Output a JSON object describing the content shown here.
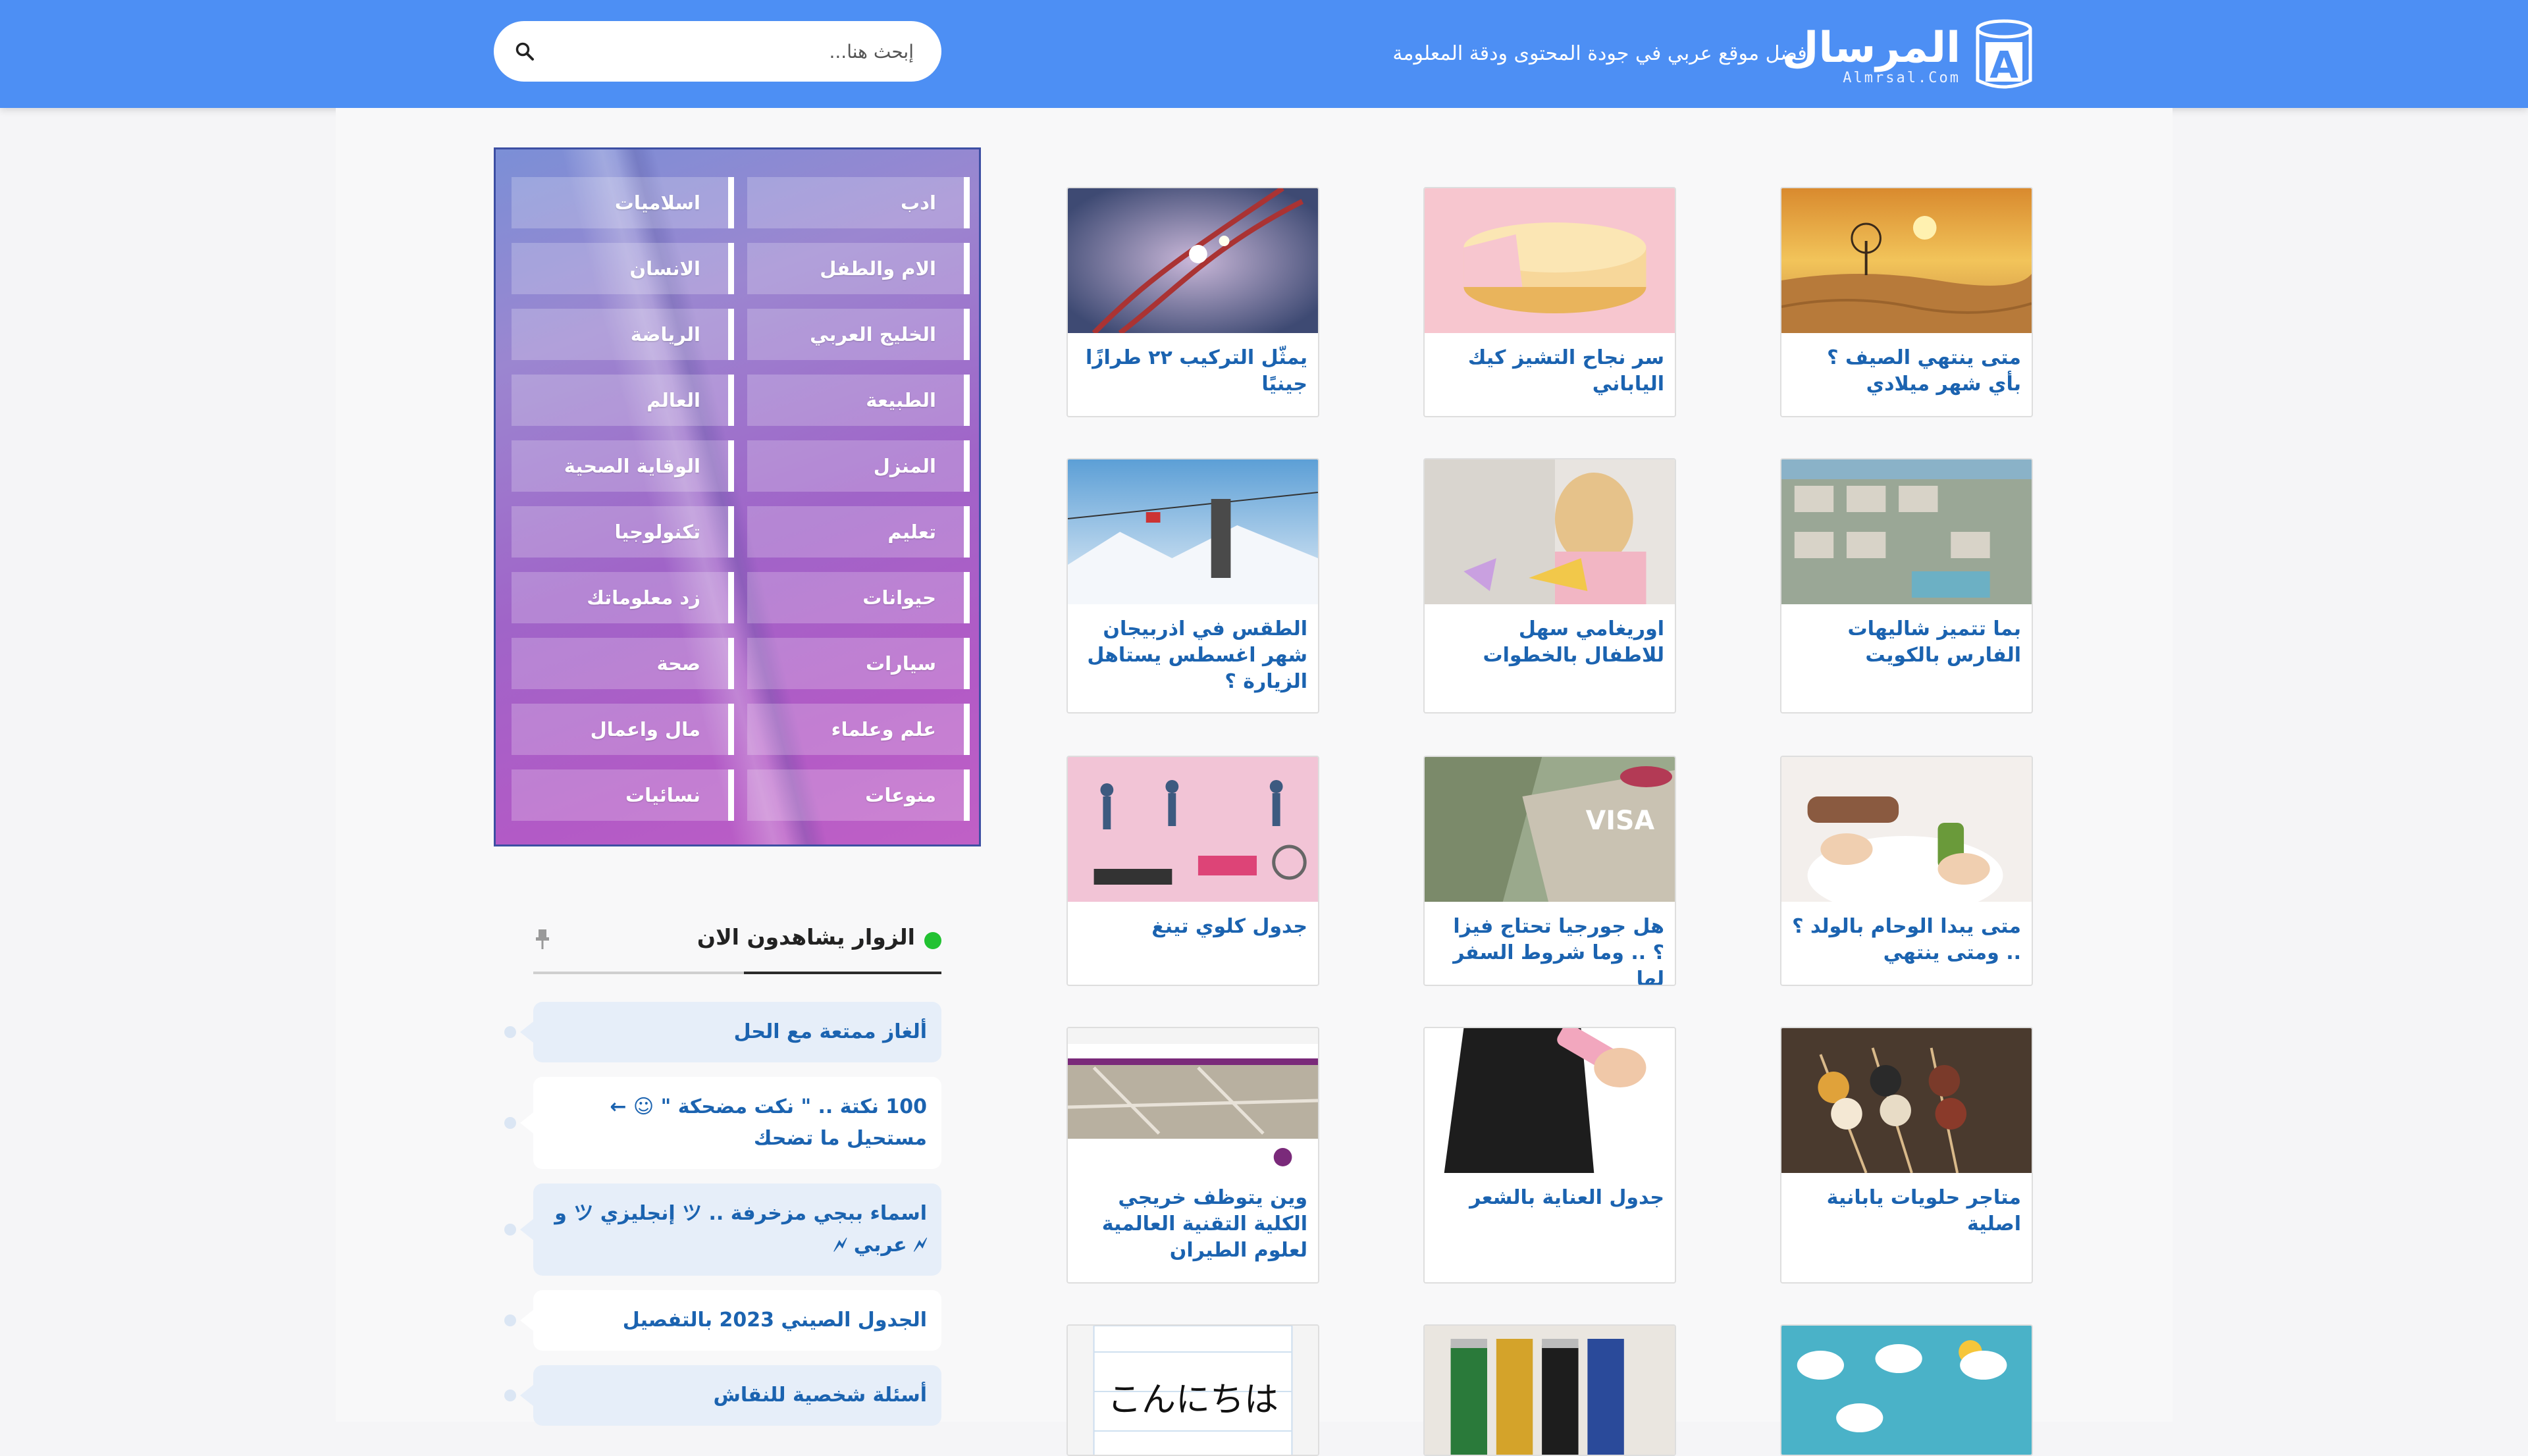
{
  "header": {
    "logo_name": "المرسال",
    "logo_domain": "Almrsal.Com",
    "tagline": "أفضل موقع عربي في جودة المحتوى ودقة المعلومة",
    "search_placeholder": "إبحث هنا...",
    "brand_color": "#4d8ff4"
  },
  "articles": [
    {
      "title": "متى ينتهي الصيف ؟ بأي شهر ميلادي",
      "image": "desert-tree"
    },
    {
      "title": "سر نجاح التشيز كيك الياباني",
      "image": "cheesecake"
    },
    {
      "title": "يمثّل التركيب ٢٢ طرازًا جينيًا",
      "image": "dna"
    },
    {
      "title": "بما تتميز شاليهات الفارس بالكويت",
      "image": "chalets-aerial"
    },
    {
      "title": "اوريغامي سهل للاطفال بالخطوات",
      "image": "origami-girl"
    },
    {
      "title": "الطقس في اذربيجان شهر اغسطس يستاهل الزيارة ؟",
      "image": "ski-lift"
    },
    {
      "title": "متى يبدا الوحام بالولد ؟ .. ومتى ينتهي",
      "image": "pregnant-food"
    },
    {
      "title": "هل جورجيا تحتاج فيزا ؟ .. وما شروط السفر لها",
      "image": "visa"
    },
    {
      "title": "جدول كلوي تينغ",
      "image": "exercise"
    },
    {
      "title": "متاجر حلويات يابانية اصلية",
      "image": "dango"
    },
    {
      "title": "جدول العناية بالشعر",
      "image": "hair-comb"
    },
    {
      "title": "وين يتوظف خريجي الكلية التقنية العالمية لعلوم الطيران",
      "image": "college-map"
    },
    {
      "title": "",
      "image": "weather-icons"
    },
    {
      "title": "",
      "image": "batteries"
    },
    {
      "title": "",
      "image": "konnichiwa",
      "image_text": "こんにちは"
    }
  ],
  "categories": [
    "ادب",
    "اسلاميات",
    "الام والطفل",
    "الانسان",
    "الخليج العربي",
    "الرياضة",
    "الطبيعة",
    "العالم",
    "المنزل",
    "الوقاية الصحية",
    "تعليم",
    "تكنولوجيا",
    "حيوانات",
    "زد معلوماتك",
    "سيارات",
    "صحة",
    "علم وعلماء",
    "مال واعمال",
    "منوعات",
    "نسائيات"
  ],
  "visitors": {
    "title": "الزوار يشاهدون الان",
    "status_color": "#22c232",
    "items": [
      "ألغاز ممتعة مع الحل",
      "100 نكتة .. \" نكت مضحكة \" ☺ ← مستحيل ما تضحك",
      "اسماء ببجي مزخرفة .. ツ إنجليزي ツ و 🗲 عربي 🗲",
      "الجدول الصيني 2023 بالتفصيل",
      "أسئلة شخصية للنقاش"
    ]
  }
}
